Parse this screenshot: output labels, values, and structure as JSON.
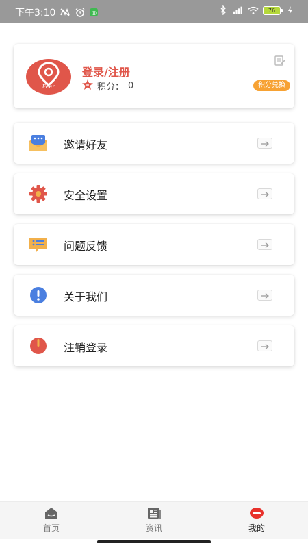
{
  "status_bar": {
    "time": "下午3:10",
    "battery": "76"
  },
  "profile": {
    "login_text": "登录/注册",
    "avatar_text": "Feer",
    "points_label": "积分：",
    "points_value": "0",
    "exchange_label": "积分兑换"
  },
  "menu": {
    "items": [
      {
        "label": "邀请好友",
        "icon": "invite-icon"
      },
      {
        "label": "安全设置",
        "icon": "gear-icon"
      },
      {
        "label": "问题反馈",
        "icon": "feedback-icon"
      },
      {
        "label": "关于我们",
        "icon": "info-icon"
      },
      {
        "label": "注销登录",
        "icon": "logout-icon"
      }
    ]
  },
  "nav": {
    "items": [
      {
        "label": "首页",
        "icon": "home-icon"
      },
      {
        "label": "资讯",
        "icon": "news-icon"
      },
      {
        "label": "我的",
        "icon": "profile-icon",
        "active": true
      }
    ]
  },
  "colors": {
    "accent": "#e0564a",
    "exchange": "#f7a233",
    "status_bar": "#999999"
  }
}
